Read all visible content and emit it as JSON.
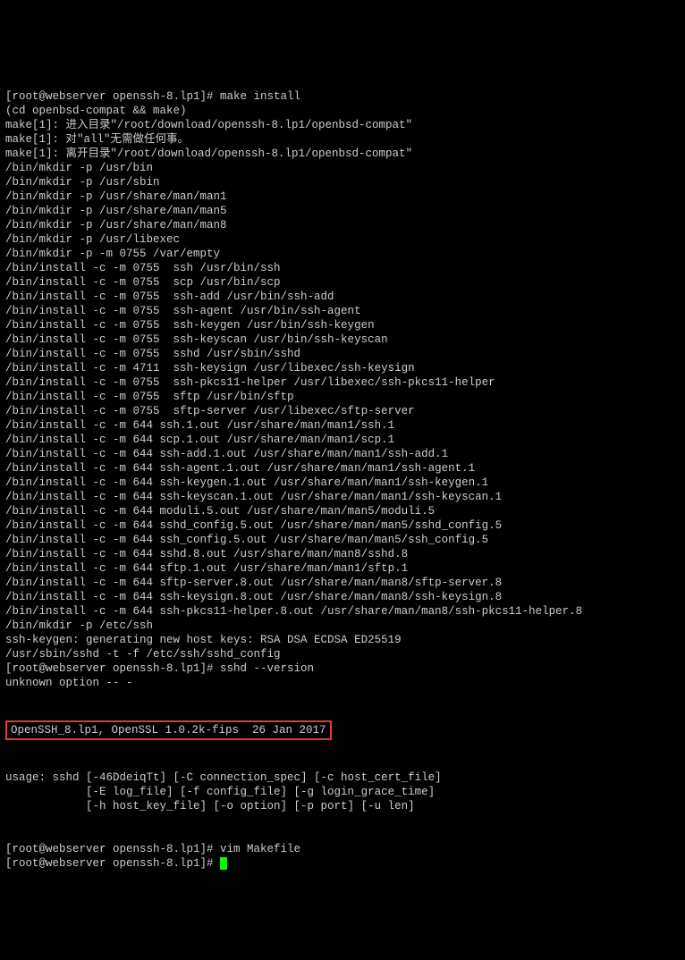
{
  "prompt_user": "root",
  "prompt_host": "webserver",
  "prompt_dir": "openssh-8.lp1",
  "commands": {
    "make_install": "make install",
    "sshd_version": "sshd --version",
    "vim_makefile": "vim Makefile"
  },
  "lines": [
    "[root@webserver openssh-8.lp1]# make install",
    "(cd openbsd-compat && make)",
    "make[1]: 进入目录\"/root/download/openssh-8.lp1/openbsd-compat\"",
    "make[1]: 对\"all\"无需做任何事。",
    "make[1]: 离开目录\"/root/download/openssh-8.lp1/openbsd-compat\"",
    "/bin/mkdir -p /usr/bin",
    "/bin/mkdir -p /usr/sbin",
    "/bin/mkdir -p /usr/share/man/man1",
    "/bin/mkdir -p /usr/share/man/man5",
    "/bin/mkdir -p /usr/share/man/man8",
    "/bin/mkdir -p /usr/libexec",
    "/bin/mkdir -p -m 0755 /var/empty",
    "/bin/install -c -m 0755  ssh /usr/bin/ssh",
    "/bin/install -c -m 0755  scp /usr/bin/scp",
    "/bin/install -c -m 0755  ssh-add /usr/bin/ssh-add",
    "/bin/install -c -m 0755  ssh-agent /usr/bin/ssh-agent",
    "/bin/install -c -m 0755  ssh-keygen /usr/bin/ssh-keygen",
    "/bin/install -c -m 0755  ssh-keyscan /usr/bin/ssh-keyscan",
    "/bin/install -c -m 0755  sshd /usr/sbin/sshd",
    "/bin/install -c -m 4711  ssh-keysign /usr/libexec/ssh-keysign",
    "/bin/install -c -m 0755  ssh-pkcs11-helper /usr/libexec/ssh-pkcs11-helper",
    "/bin/install -c -m 0755  sftp /usr/bin/sftp",
    "/bin/install -c -m 0755  sftp-server /usr/libexec/sftp-server",
    "/bin/install -c -m 644 ssh.1.out /usr/share/man/man1/ssh.1",
    "/bin/install -c -m 644 scp.1.out /usr/share/man/man1/scp.1",
    "/bin/install -c -m 644 ssh-add.1.out /usr/share/man/man1/ssh-add.1",
    "/bin/install -c -m 644 ssh-agent.1.out /usr/share/man/man1/ssh-agent.1",
    "/bin/install -c -m 644 ssh-keygen.1.out /usr/share/man/man1/ssh-keygen.1",
    "/bin/install -c -m 644 ssh-keyscan.1.out /usr/share/man/man1/ssh-keyscan.1",
    "/bin/install -c -m 644 moduli.5.out /usr/share/man/man5/moduli.5",
    "/bin/install -c -m 644 sshd_config.5.out /usr/share/man/man5/sshd_config.5",
    "/bin/install -c -m 644 ssh_config.5.out /usr/share/man/man5/ssh_config.5",
    "/bin/install -c -m 644 sshd.8.out /usr/share/man/man8/sshd.8",
    "/bin/install -c -m 644 sftp.1.out /usr/share/man/man1/sftp.1",
    "/bin/install -c -m 644 sftp-server.8.out /usr/share/man/man8/sftp-server.8",
    "/bin/install -c -m 644 ssh-keysign.8.out /usr/share/man/man8/ssh-keysign.8",
    "/bin/install -c -m 644 ssh-pkcs11-helper.8.out /usr/share/man/man8/ssh-pkcs11-helper.8",
    "/bin/mkdir -p /etc/ssh",
    "ssh-keygen: generating new host keys: RSA DSA ECDSA ED25519",
    "/usr/sbin/sshd -t -f /etc/ssh/sshd_config",
    "[root@webserver openssh-8.lp1]# sshd --version",
    "unknown option -- -"
  ],
  "highlighted": "OpenSSH_8.lp1, OpenSSL 1.0.2k-fips  26 Jan 2017",
  "usage_lines": [
    "usage: sshd [-46DdeiqTt] [-C connection_spec] [-c host_cert_file]",
    "            [-E log_file] [-f config_file] [-g login_grace_time]",
    "            [-h host_key_file] [-o option] [-p port] [-u len]"
  ],
  "final_lines": [
    "[root@webserver openssh-8.lp1]# vim Makefile",
    "[root@webserver openssh-8.lp1]# "
  ]
}
